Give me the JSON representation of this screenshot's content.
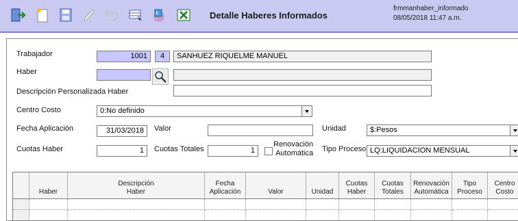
{
  "toolbar": {
    "title": "Detalle Haberes Informados",
    "form_name": "frmmanhaber_informado",
    "datetime": "08/05/2018 11:47 a.m.",
    "icons": [
      "exit-icon",
      "new-icon",
      "save-icon",
      "edit-icon",
      "undo-icon",
      "query-icon",
      "print-icon",
      "excel-icon"
    ]
  },
  "form": {
    "trabajador": {
      "label": "Trabajador",
      "code": "1001",
      "dv": "4",
      "name": "SANHUEZ RIQUELME MANUEL"
    },
    "haber": {
      "label": "Haber",
      "code": "",
      "desc": ""
    },
    "descripcion": {
      "label": "Descripción Personalizada Haber",
      "value": ""
    },
    "centro_costo": {
      "label": "Centro Costo",
      "value": "0:No definido"
    },
    "fecha_aplicacion": {
      "label": "Fecha Aplicación",
      "value": "31/03/2018"
    },
    "valor": {
      "label": "Valor",
      "value": ""
    },
    "unidad": {
      "label": "Unidad",
      "value": "$:Pesos"
    },
    "cuotas_haber": {
      "label": "Cuotas Haber",
      "value": "1"
    },
    "cuotas_totales": {
      "label": "Cuotas Totales",
      "value": "1"
    },
    "renovacion": {
      "label": "Renovación\nAutomática"
    },
    "tipo_proceso": {
      "label": "Tipo Proceso",
      "value": "LQ:LIQUIDACION MENSUAL"
    }
  },
  "grid": {
    "columns": [
      "Haber",
      "Descripción\nHaber",
      "Fecha\nAplicación",
      "Valor",
      "Unidad",
      "Cuotas\nHaber",
      "Cuotas\nTotales",
      "Renovación\nAutomática",
      "Tipo\nProceso",
      "Centro\nCosto"
    ]
  }
}
